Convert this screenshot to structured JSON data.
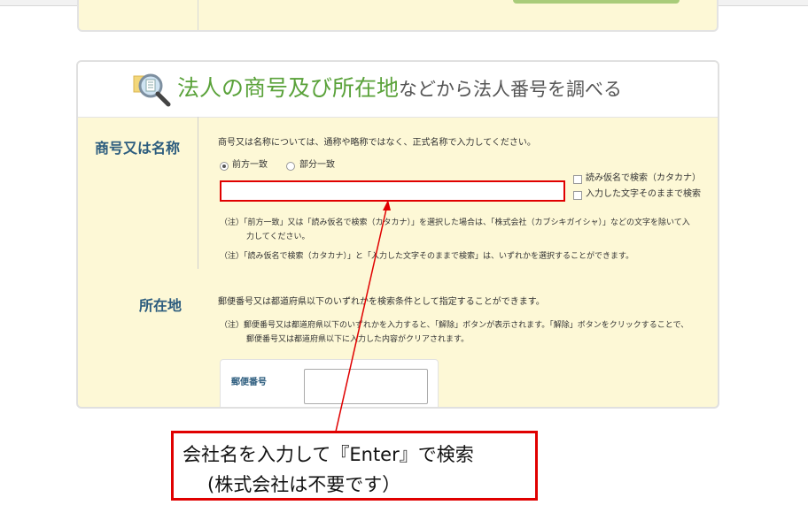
{
  "header": {
    "title_highlight": "法人の商号及び所在地",
    "title_rest": "などから法人番号を調べる"
  },
  "name_section": {
    "label": "商号又は名称",
    "instruction": "商号又は名称については、通称や略称ではなく、正式名称で入力してください。",
    "match_options": [
      {
        "label": "前方一致",
        "selected": true
      },
      {
        "label": "部分一致",
        "selected": false
      }
    ],
    "checkboxes": [
      {
        "label": "読み仮名で検索（カタカナ）",
        "checked": false
      },
      {
        "label": "入力した文字そのままで検索",
        "checked": false
      }
    ],
    "input_value": "",
    "note1_line1": "（注）「前方一致」又は「読み仮名で検索（カタカナ）」を選択した場合は、「株式会社（カブシキガイシャ）」などの文字を除いて入",
    "note1_line2": "力してください。",
    "note2": "（注）「読み仮名で検索（カタカナ）」と「入力した文字そのままで検索」は、いずれかを選択することができます。"
  },
  "address_section": {
    "label": "所在地",
    "instruction": "郵便番号又は都道府県以下のいずれかを検索条件として指定することができます。",
    "note_line1": "（注）郵便番号又は都道府県以下のいずれかを入力すると、「解除」ボタンが表示されます。「解除」ボタンをクリックすることで、",
    "note_line2": "郵便番号又は都道府県以下に入力した内容がクリアされます。",
    "postal_label": "郵便番号",
    "postal_value": ""
  },
  "annotation": {
    "line1": "会社名を入力して『Enter』で検索",
    "line2": "(株式会社は不要です）",
    "color": "#e00000"
  }
}
